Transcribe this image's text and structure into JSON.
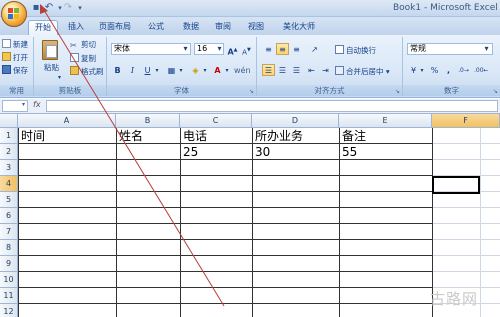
{
  "window": {
    "title": "Book1 - Microsoft Excel"
  },
  "tabs": [
    "开始",
    "插入",
    "页面布局",
    "公式",
    "数据",
    "审阅",
    "视图",
    "美化大师"
  ],
  "clipboard": {
    "new": "新建",
    "open": "打开",
    "save": "保存",
    "paste": "粘贴",
    "cut": "剪切",
    "copy": "复制",
    "format_painter": "格式刷",
    "group_common": "常用",
    "group_label": "剪贴板"
  },
  "font": {
    "name": "宋体",
    "size": "16",
    "group_label": "字体",
    "grow": "A",
    "shrink": "A",
    "bold": "B",
    "italic": "I",
    "underline": "U"
  },
  "alignment": {
    "wrap_text": "自动换行",
    "merge_center": "合并后居中",
    "group_label": "对齐方式"
  },
  "number": {
    "format": "常规",
    "percent": "%",
    "comma": ",",
    "group_label": "数字"
  },
  "formula_bar": {
    "fx": "fx"
  },
  "columns": [
    "A",
    "B",
    "C",
    "D",
    "E",
    "F"
  ],
  "rows": [
    "1",
    "2",
    "3",
    "4",
    "5",
    "6",
    "7",
    "8",
    "9",
    "10",
    "11",
    "12"
  ],
  "cells": {
    "a1": "时间",
    "b1": "姓名",
    "c1": "电话",
    "d1": "所办业务",
    "e1": "备注",
    "c2": "25",
    "d2": "30",
    "e2": "55"
  },
  "watermark": "古路网",
  "selected_cell": "F4"
}
